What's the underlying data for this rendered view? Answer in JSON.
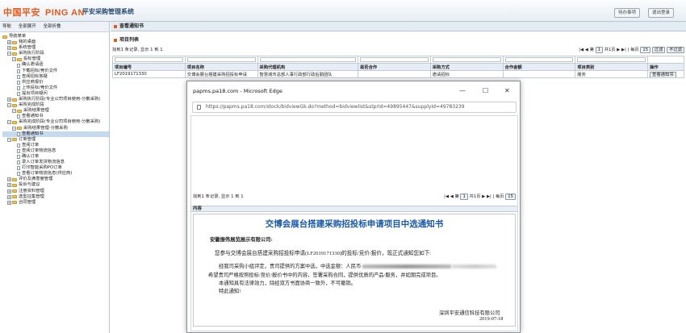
{
  "header": {
    "brand_cn": "中国平安",
    "brand_en": "PING AN",
    "system": "平安采购管理系统",
    "btn_todo": "待办事项",
    "btn_logout": "退出登录"
  },
  "sidebar": {
    "tab_nav": "导航",
    "expand_all": "全部展开",
    "collapse_all": "全部折叠",
    "tree": [
      {
        "l": 0,
        "t": "root",
        "label": "导航菜单"
      },
      {
        "l": 1,
        "t": "plus",
        "label": "我的桌面"
      },
      {
        "l": 1,
        "t": "plus",
        "label": "系统管理"
      },
      {
        "l": 1,
        "t": "minus",
        "label": "采购执行阶段"
      },
      {
        "l": 2,
        "t": "minus",
        "label": "投标管理"
      },
      {
        "l": 3,
        "t": "doc",
        "label": "确认邀请函"
      },
      {
        "l": 3,
        "t": "doc",
        "label": "下载招标/竞价文件"
      },
      {
        "l": 3,
        "t": "doc",
        "label": "查阅招标答疑"
      },
      {
        "l": 3,
        "t": "doc",
        "label": "供应商报价"
      },
      {
        "l": 3,
        "t": "doc",
        "label": "上传投标/竞价文件"
      },
      {
        "l": 3,
        "t": "doc",
        "label": "提出项目疑问"
      },
      {
        "l": 1,
        "t": "plus",
        "label": "采购执行阶段(专业公司项目使用-分散采购)"
      },
      {
        "l": 1,
        "t": "minus",
        "label": "采购完成阶段"
      },
      {
        "l": 2,
        "t": "minus",
        "label": "采购结果管理"
      },
      {
        "l": 3,
        "t": "doc",
        "label": "查看通知书"
      },
      {
        "l": 1,
        "t": "minus",
        "label": "采购完成阶段(专业公司项目使用-分散采购)"
      },
      {
        "l": 2,
        "t": "minus",
        "label": "采购结果管理-分散采购"
      },
      {
        "l": 3,
        "t": "doc",
        "label": "查看通知书",
        "sel": true
      },
      {
        "l": 1,
        "t": "minus",
        "label": "订单管理"
      },
      {
        "l": 3,
        "t": "doc",
        "label": "查阅订单"
      },
      {
        "l": 3,
        "t": "doc",
        "label": "查阅订单物流信息"
      },
      {
        "l": 3,
        "t": "doc",
        "label": "确认订单"
      },
      {
        "l": 3,
        "t": "doc",
        "label": "录入订单发货物流信息"
      },
      {
        "l": 3,
        "t": "doc",
        "label": "打印智能采购PO订单"
      },
      {
        "l": 3,
        "t": "doc",
        "label": "查看订单物流信息(供应商)"
      },
      {
        "l": 1,
        "t": "plus",
        "label": "评价及满意度管理"
      },
      {
        "l": 1,
        "t": "plus",
        "label": "投诉与建议"
      },
      {
        "l": 1,
        "t": "plus",
        "label": "注册资料管理"
      },
      {
        "l": 1,
        "t": "plus",
        "label": "选型征集管理"
      },
      {
        "l": 1,
        "t": "plus",
        "label": "合同管理"
      }
    ]
  },
  "main": {
    "title": "查看通知书",
    "list_title": "项目列表",
    "found": "找到1 条记录, 显示 1 到 1",
    "page_label": "第",
    "page_value": "1",
    "page_total": "共1页",
    "per_page": "每页",
    "per_value": "15",
    "filter": "过滤",
    "unfilter": "不过滤",
    "columns": [
      "项目编号",
      "项目名称",
      "采购代理机构",
      "是否合作",
      "采购方式",
      "合作金额",
      "项目类别",
      "操作"
    ],
    "rows": [
      [
        "LF2019171330",
        "交博会展台搭建采购招投标申请",
        "智慧城市总部人事行政部行政后勤团队",
        "",
        "邀请招标",
        "",
        "服务",
        "查看通知书"
      ]
    ]
  },
  "popup": {
    "title": "papms.pa18.com - Microsoft Edge",
    "url": "https://papms.pa18.com/stock/bidviewGk.do?method=bidviewlist&stprId=49895447&supplyId=49783239",
    "found": "找到1 条记录, 显示 1 到 1",
    "page_value": "1",
    "page_total": "共1页",
    "per_value": "15",
    "content_label": "内容",
    "doc": {
      "heading": "交博会展台搭建采购招投标申请项目中选通知书",
      "recipient": "安徽振伟展览展示有限公司:",
      "line1": "您参与交博会展台搭建采购招投标申请(LF2019171330)的投标/竞价/报价，现正式通知您如下:",
      "line2a": "经我司采购小组评定，贵司提供的方案中选，中选金额：人民币",
      "line3": "希望贵司严格按照投标/竞价/报价书中的内容，签署采购合同，提供优质的产品/服务，并如期完成项目。",
      "line4": "本通知具有法律效力，除经双方书面协商一致外，不可撤销。",
      "line5": "特此通知!",
      "signer": "深圳平安通信科技有限公司",
      "date": "2019-07-18"
    }
  }
}
